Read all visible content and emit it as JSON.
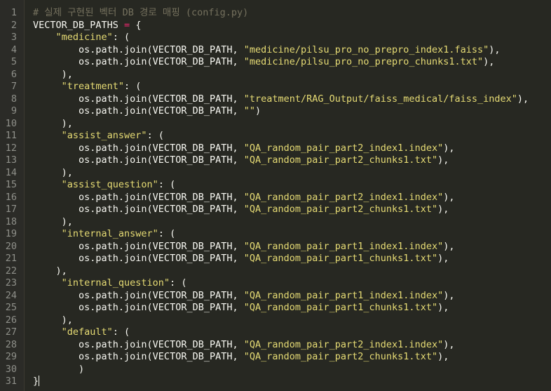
{
  "editor": {
    "lines": [
      {
        "n": "1",
        "tokens": [
          {
            "t": "# 실제 구현된 벡터 DB 경로 매핑 (config.py)",
            "c": "t-comment"
          }
        ]
      },
      {
        "n": "2",
        "tokens": [
          {
            "t": "VECTOR_DB_PATHS ",
            "c": "t-text"
          },
          {
            "t": "=",
            "c": "t-op"
          },
          {
            "t": " {",
            "c": "t-text"
          }
        ]
      },
      {
        "n": "3",
        "tokens": [
          {
            "t": "    ",
            "c": "t-text"
          },
          {
            "t": "\"medicine\"",
            "c": "t-str"
          },
          {
            "t": ": (",
            "c": "t-text"
          }
        ]
      },
      {
        "n": "4",
        "tokens": [
          {
            "t": "        os.path.join(VECTOR_DB_PATH, ",
            "c": "t-text"
          },
          {
            "t": "\"medicine/pilsu_pro_no_prepro_index1.faiss\"",
            "c": "t-str"
          },
          {
            "t": "),",
            "c": "t-text"
          }
        ]
      },
      {
        "n": "5",
        "tokens": [
          {
            "t": "        os.path.join(VECTOR_DB_PATH, ",
            "c": "t-text"
          },
          {
            "t": "\"medicine/pilsu_pro_no_prepro_chunks1.txt\"",
            "c": "t-str"
          },
          {
            "t": "),",
            "c": "t-text"
          }
        ]
      },
      {
        "n": "6",
        "tokens": [
          {
            "t": "     ),",
            "c": "t-text"
          }
        ]
      },
      {
        "n": "7",
        "tokens": [
          {
            "t": "     ",
            "c": "t-text"
          },
          {
            "t": "\"treatment\"",
            "c": "t-str"
          },
          {
            "t": ": (",
            "c": "t-text"
          }
        ]
      },
      {
        "n": "8",
        "tokens": [
          {
            "t": "        os.path.join(VECTOR_DB_PATH, ",
            "c": "t-text"
          },
          {
            "t": "\"treatment/RAG_Output/faiss_medical/faiss_index\"",
            "c": "t-str"
          },
          {
            "t": "),",
            "c": "t-text"
          }
        ]
      },
      {
        "n": "9",
        "tokens": [
          {
            "t": "        os.path.join(VECTOR_DB_PATH, ",
            "c": "t-text"
          },
          {
            "t": "\"\"",
            "c": "t-str"
          },
          {
            "t": ")",
            "c": "t-text"
          }
        ]
      },
      {
        "n": "10",
        "tokens": [
          {
            "t": "     ),",
            "c": "t-text"
          }
        ]
      },
      {
        "n": "11",
        "tokens": [
          {
            "t": "     ",
            "c": "t-text"
          },
          {
            "t": "\"assist_answer\"",
            "c": "t-str"
          },
          {
            "t": ": (",
            "c": "t-text"
          }
        ]
      },
      {
        "n": "12",
        "tokens": [
          {
            "t": "        os.path.join(VECTOR_DB_PATH, ",
            "c": "t-text"
          },
          {
            "t": "\"QA_random_pair_part2_index1.index\"",
            "c": "t-str"
          },
          {
            "t": "),",
            "c": "t-text"
          }
        ]
      },
      {
        "n": "13",
        "tokens": [
          {
            "t": "        os.path.join(VECTOR_DB_PATH, ",
            "c": "t-text"
          },
          {
            "t": "\"QA_random_pair_part2_chunks1.txt\"",
            "c": "t-str"
          },
          {
            "t": "),",
            "c": "t-text"
          }
        ]
      },
      {
        "n": "14",
        "tokens": [
          {
            "t": "     ),",
            "c": "t-text"
          }
        ]
      },
      {
        "n": "15",
        "tokens": [
          {
            "t": "     ",
            "c": "t-text"
          },
          {
            "t": "\"assist_question\"",
            "c": "t-str"
          },
          {
            "t": ": (",
            "c": "t-text"
          }
        ]
      },
      {
        "n": "16",
        "tokens": [
          {
            "t": "        os.path.join(VECTOR_DB_PATH, ",
            "c": "t-text"
          },
          {
            "t": "\"QA_random_pair_part2_index1.index\"",
            "c": "t-str"
          },
          {
            "t": "),",
            "c": "t-text"
          }
        ]
      },
      {
        "n": "17",
        "tokens": [
          {
            "t": "        os.path.join(VECTOR_DB_PATH, ",
            "c": "t-text"
          },
          {
            "t": "\"QA_random_pair_part2_chunks1.txt\"",
            "c": "t-str"
          },
          {
            "t": "),",
            "c": "t-text"
          }
        ]
      },
      {
        "n": "18",
        "tokens": [
          {
            "t": "     ),",
            "c": "t-text"
          }
        ]
      },
      {
        "n": "19",
        "tokens": [
          {
            "t": "     ",
            "c": "t-text"
          },
          {
            "t": "\"internal_answer\"",
            "c": "t-str"
          },
          {
            "t": ": (",
            "c": "t-text"
          }
        ]
      },
      {
        "n": "20",
        "tokens": [
          {
            "t": "        os.path.join(VECTOR_DB_PATH, ",
            "c": "t-text"
          },
          {
            "t": "\"QA_random_pair_part1_index1.index\"",
            "c": "t-str"
          },
          {
            "t": "),",
            "c": "t-text"
          }
        ]
      },
      {
        "n": "21",
        "tokens": [
          {
            "t": "        os.path.join(VECTOR_DB_PATH, ",
            "c": "t-text"
          },
          {
            "t": "\"QA_random_pair_part1_chunks1.txt\"",
            "c": "t-str"
          },
          {
            "t": "),",
            "c": "t-text"
          }
        ]
      },
      {
        "n": "22",
        "tokens": [
          {
            "t": "    ),",
            "c": "t-text"
          }
        ]
      },
      {
        "n": "23",
        "tokens": [
          {
            "t": "     ",
            "c": "t-text"
          },
          {
            "t": "\"internal_question\"",
            "c": "t-str"
          },
          {
            "t": ": (",
            "c": "t-text"
          }
        ]
      },
      {
        "n": "24",
        "tokens": [
          {
            "t": "        os.path.join(VECTOR_DB_PATH, ",
            "c": "t-text"
          },
          {
            "t": "\"QA_random_pair_part1_index1.index\"",
            "c": "t-str"
          },
          {
            "t": "),",
            "c": "t-text"
          }
        ]
      },
      {
        "n": "25",
        "tokens": [
          {
            "t": "        os.path.join(VECTOR_DB_PATH, ",
            "c": "t-text"
          },
          {
            "t": "\"QA_random_pair_part1_chunks1.txt\"",
            "c": "t-str"
          },
          {
            "t": "),",
            "c": "t-text"
          }
        ]
      },
      {
        "n": "26",
        "tokens": [
          {
            "t": "     ),",
            "c": "t-text"
          }
        ]
      },
      {
        "n": "27",
        "tokens": [
          {
            "t": "     ",
            "c": "t-text"
          },
          {
            "t": "\"default\"",
            "c": "t-str"
          },
          {
            "t": ": (",
            "c": "t-text"
          }
        ]
      },
      {
        "n": "28",
        "tokens": [
          {
            "t": "        os.path.join(VECTOR_DB_PATH, ",
            "c": "t-text"
          },
          {
            "t": "\"QA_random_pair_part2_index1.index\"",
            "c": "t-str"
          },
          {
            "t": "),",
            "c": "t-text"
          }
        ]
      },
      {
        "n": "29",
        "tokens": [
          {
            "t": "        os.path.join(VECTOR_DB_PATH, ",
            "c": "t-text"
          },
          {
            "t": "\"QA_random_pair_part2_chunks1.txt\"",
            "c": "t-str"
          },
          {
            "t": "),",
            "c": "t-text"
          }
        ]
      },
      {
        "n": "30",
        "tokens": [
          {
            "t": "        )",
            "c": "t-text"
          }
        ]
      },
      {
        "n": "31",
        "tokens": [
          {
            "t": "}",
            "c": "t-text"
          }
        ],
        "cursor": true
      }
    ],
    "colors": {
      "background": "#272822",
      "gutter": "#2b2b27",
      "line_number": "#8f908a",
      "text": "#f8f8f2",
      "comment": "#75715e",
      "string": "#e6db74",
      "operator": "#f92672"
    }
  }
}
